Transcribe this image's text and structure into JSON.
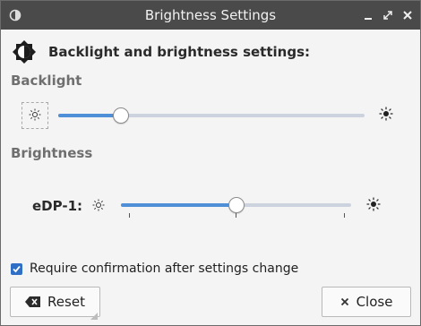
{
  "window": {
    "title": "Brightness Settings",
    "icons": {
      "app": "display-icon",
      "minimize": "minimize-icon",
      "maximize": "maximize-icon",
      "close": "close-icon"
    }
  },
  "header": {
    "text": "Backlight and brightness settings:",
    "icon": "brightness-icon"
  },
  "backlight": {
    "section_title": "Backlight",
    "level_fraction": 0.205,
    "icons": {
      "low": "sun-dim-icon",
      "high": "sun-bright-icon"
    }
  },
  "brightness": {
    "section_title": "Brightness",
    "outputs": [
      {
        "label": "eDP-1:",
        "level_fraction": 0.5
      }
    ],
    "icons": {
      "low": "sun-dim-icon",
      "high": "sun-bright-icon"
    }
  },
  "confirmation": {
    "label": "Require confirmation after settings change",
    "checked": true
  },
  "buttons": {
    "reset_label": "Reset",
    "close_label": "Close"
  },
  "colors": {
    "accent": "#4f8fd8",
    "titlebar": "#4a4a4a",
    "checkbox": "#2f6fc5"
  }
}
